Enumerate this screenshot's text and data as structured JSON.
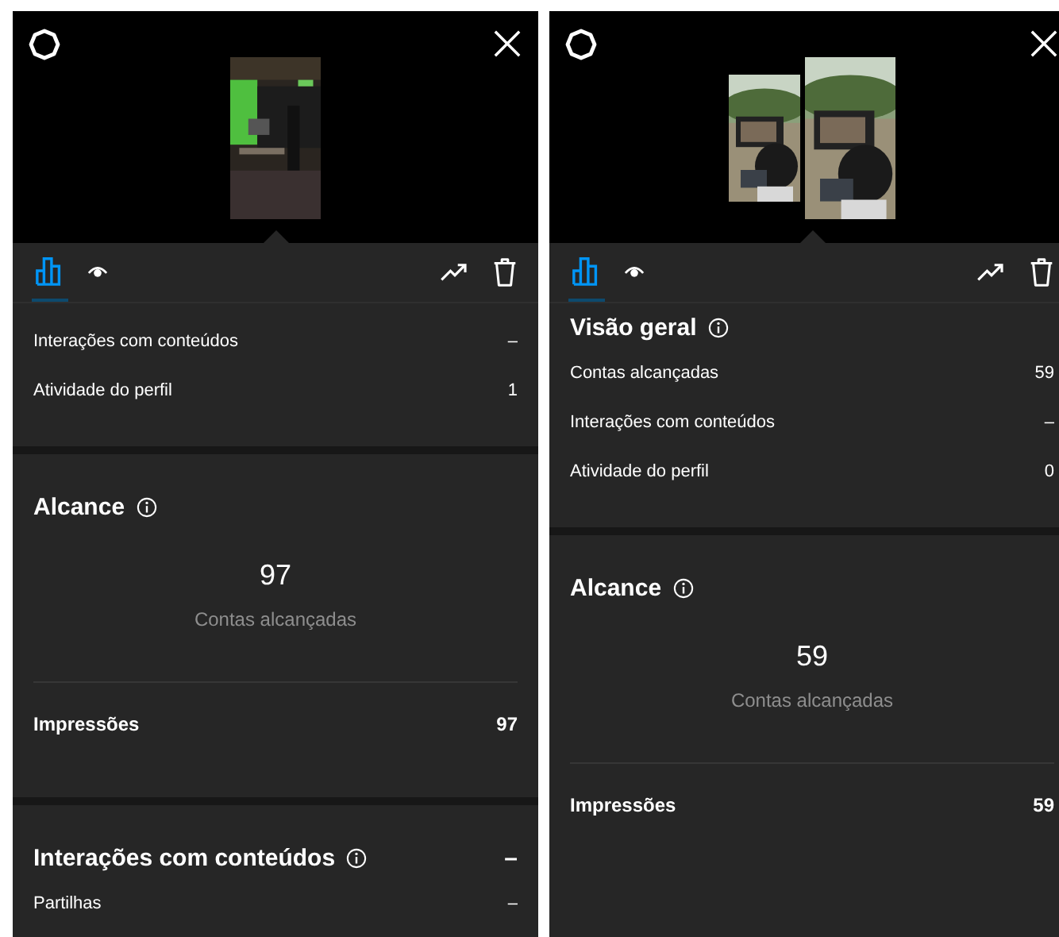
{
  "panels": [
    {
      "thumbnails": [
        {
          "kind": "picture"
        }
      ],
      "tabs": [
        {
          "kind": "chart",
          "selected": true
        },
        {
          "kind": "eye",
          "selected": false
        }
      ],
      "sections": [
        {
          "kind": "list",
          "rows": [
            {
              "label": "Interações com conteúdos",
              "value": "–"
            },
            {
              "label": "Atividade do perfil",
              "value": "1"
            }
          ]
        },
        {
          "kind": "reach",
          "title": "Alcance",
          "value": "97",
          "caption": "Contas alcançadas",
          "footer": {
            "label": "Impressões",
            "value": "97"
          }
        },
        {
          "kind": "list",
          "title": "Interações com conteúdos",
          "value": "–",
          "rows": [
            {
              "label": "Partilhas",
              "value": "–"
            }
          ]
        }
      ]
    },
    {
      "thumbnails": [
        {
          "kind": "picture"
        },
        {
          "kind": "picture"
        }
      ],
      "tabs": [
        {
          "kind": "chart",
          "selected": true
        },
        {
          "kind": "eye",
          "selected": false
        }
      ],
      "sections": [
        {
          "kind": "list",
          "title": "Visão geral",
          "rows": [
            {
              "label": "Contas alcançadas",
              "value": "59"
            },
            {
              "label": "Interações com conteúdos",
              "value": "–"
            },
            {
              "label": "Atividade do perfil",
              "value": "0"
            }
          ]
        },
        {
          "kind": "reach",
          "title": "Alcance",
          "value": "59",
          "caption": "Contas alcançadas",
          "footer": {
            "label": "Impressões",
            "value": "59"
          }
        }
      ]
    }
  ]
}
